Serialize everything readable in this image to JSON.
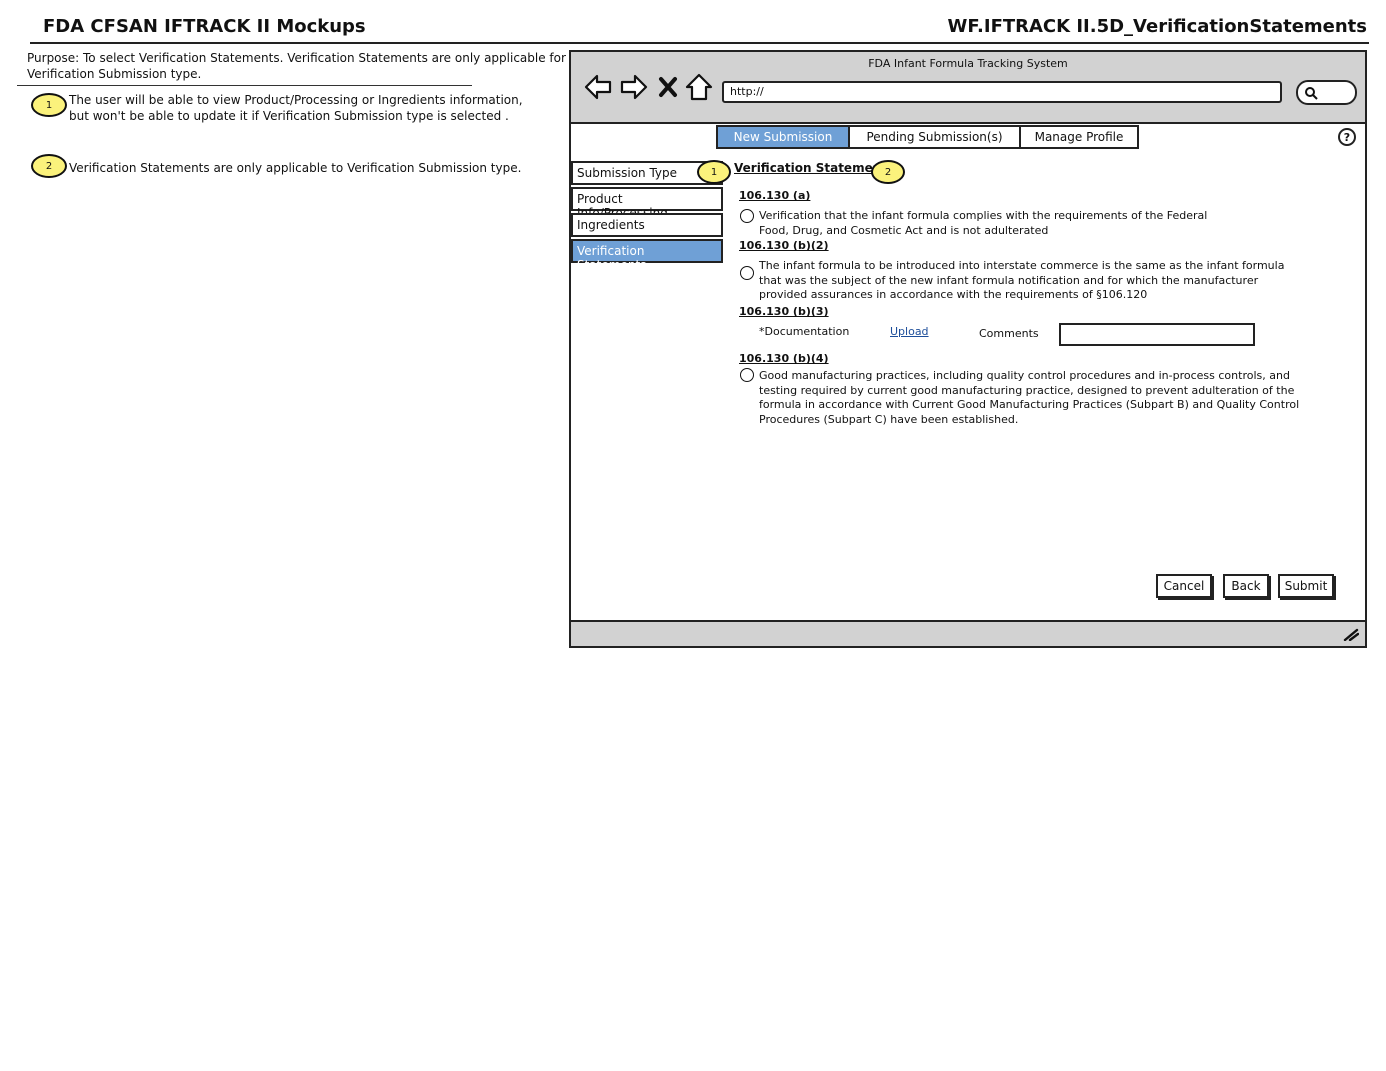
{
  "header": {
    "title": "FDA CFSAN IFTRACK II Mockups",
    "screen_id": "WF.IFTRACK II.5D_VerificationStatements"
  },
  "purpose": "Purpose: To select Verification Statements. Verification Statements are only applicable for Verification Submission type.",
  "notes": [
    {
      "marker": "1",
      "text": "The user will be able to view Product/Processing or Ingredients information, but won't be able to update it if Verification Submission type is selected ."
    },
    {
      "marker": "2",
      "text": "Verification Statements are only applicable to Verification Submission type."
    }
  ],
  "browser": {
    "title": "FDA Infant Formula Tracking System",
    "url": "http://"
  },
  "tabs": [
    {
      "label": "New Submission",
      "active": true
    },
    {
      "label": "Pending Submission(s)",
      "active": false
    },
    {
      "label": "Manage Profile",
      "active": false
    }
  ],
  "help_label": "?",
  "sidebar": {
    "items": [
      {
        "label": "Submission Type"
      },
      {
        "label": "Product Info/Processing"
      },
      {
        "label": "Ingredients"
      },
      {
        "label": "Verification Statements",
        "active": true
      }
    ]
  },
  "content": {
    "title": "Verification Statements",
    "sections": [
      {
        "code": "106.130 (a)",
        "text": "Verification that the infant formula complies with the requirements of the Federal Food, Drug,  and Cosmetic Act and is not adulterated"
      },
      {
        "code": "106.130 (b)(2)",
        "text": "The infant formula to be introduced into interstate commerce is the same as the infant formula that was the subject of the new infant formula notification and for which the manufacturer provided assurances in accordance with the requirements of §106.120"
      },
      {
        "code": "106.130 (b)(3)",
        "doc_label": "*Documentation",
        "upload_label": "Upload",
        "comments_label": "Comments"
      },
      {
        "code": "106.130 (b)(4)",
        "text": "Good manufacturing practices, including quality control procedures and in-process controls, and testing required by current good manufacturing practice, designed to prevent adulteration of the formula in accordance with Current Good Manufacturing Practices (Subpart B) and  Quality Control Procedures (Subpart C) have been established."
      }
    ]
  },
  "buttons": {
    "cancel": "Cancel",
    "back": "Back",
    "submit": "Submit"
  },
  "colors": {
    "active_tab": "#6fa0d6",
    "marker": "#fbf27c",
    "chrome": "#d2d2d2",
    "link": "#1d4e9a"
  }
}
